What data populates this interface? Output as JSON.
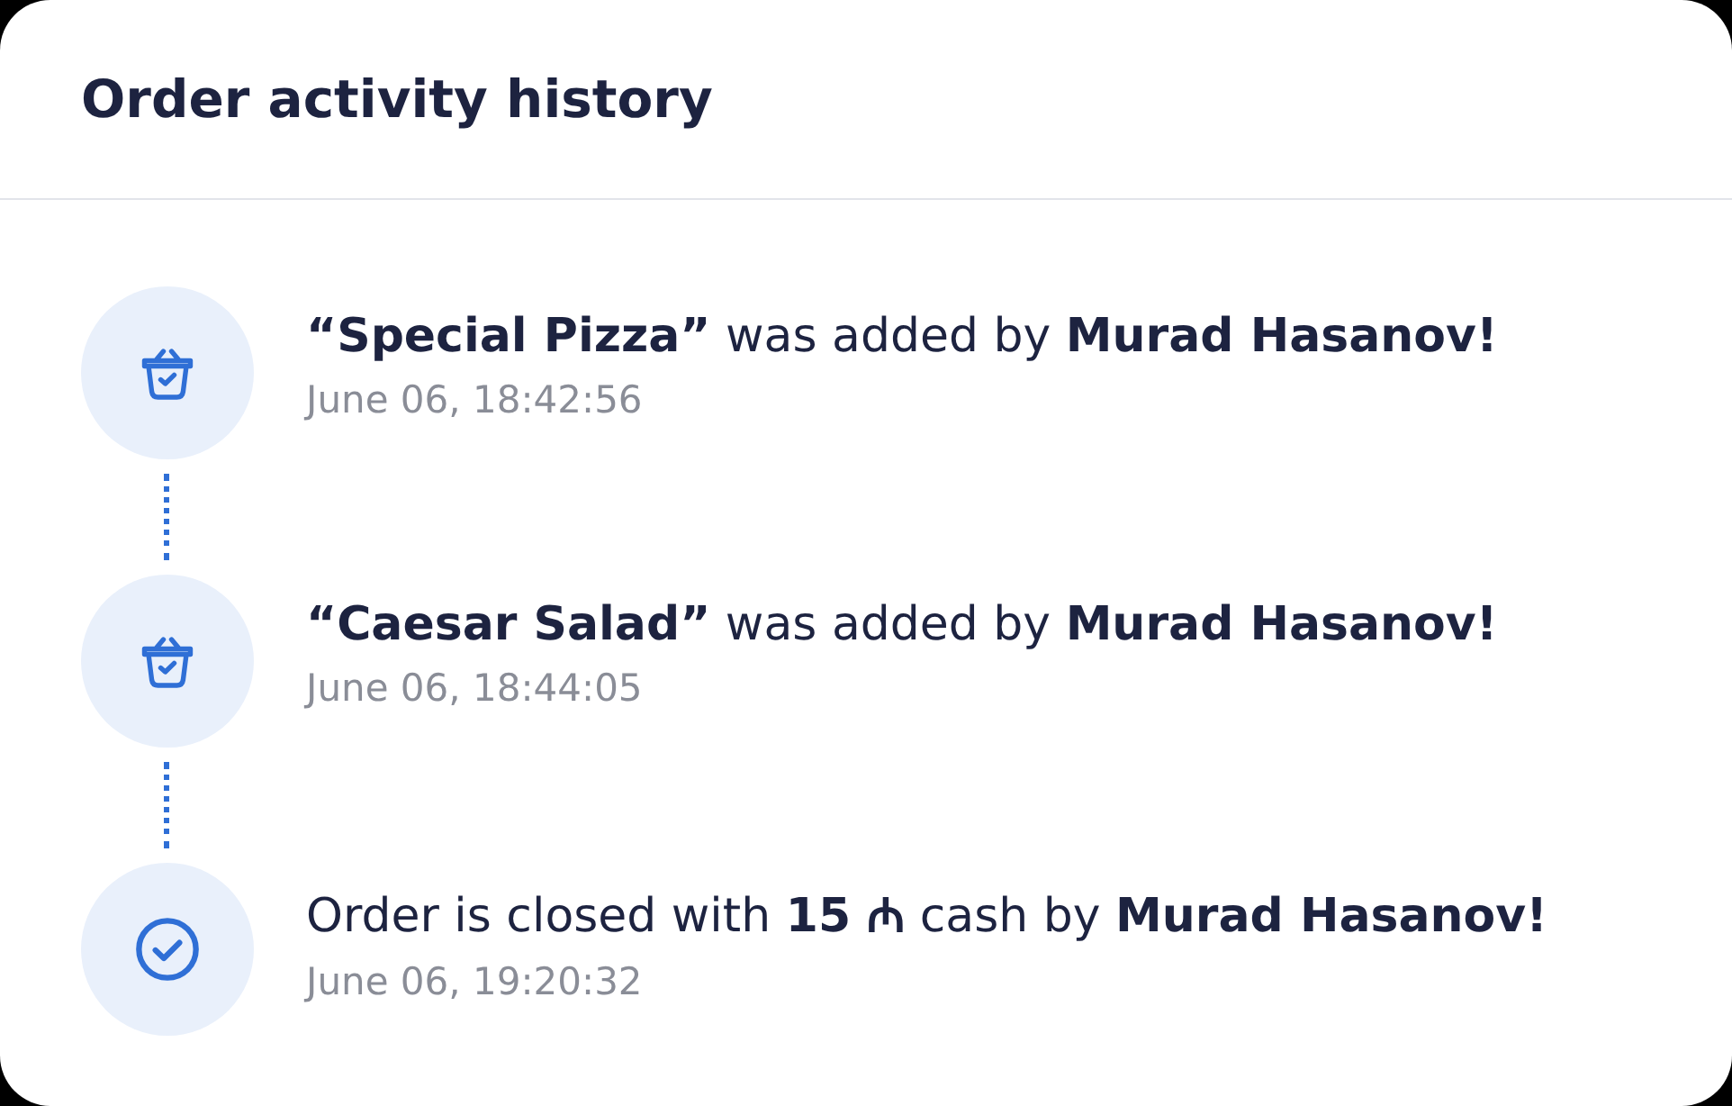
{
  "card": {
    "title": "Order activity history"
  },
  "events": [
    {
      "kind": "basket",
      "text": "**“Special Pizza”** was added by **Murad Hasanov!**",
      "time": "June 06, 18:42:56"
    },
    {
      "kind": "basket",
      "text": "**“Caesar Salad”** was added by **Murad Hasanov!**",
      "time": "June 06, 18:44:05"
    },
    {
      "kind": "check",
      "text": "Order is closed with **15 ₼** cash by **Murad Hasanov!**",
      "time": "June 06, 19:20:32"
    }
  ]
}
